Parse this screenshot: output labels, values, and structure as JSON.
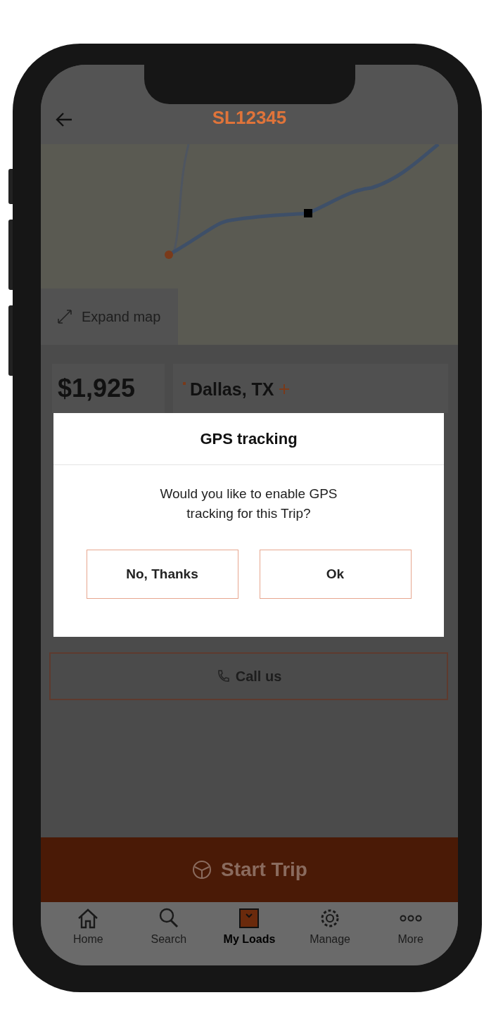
{
  "header": {
    "title": "SL12345"
  },
  "map": {
    "expand_label": "Expand map"
  },
  "summary": {
    "price": "$1,925",
    "origin": "Dallas, TX"
  },
  "call_button": {
    "label": "Call us"
  },
  "start_button": {
    "label": "Start Trip"
  },
  "nav": [
    {
      "label": "Home",
      "selected": false
    },
    {
      "label": "Search",
      "selected": false
    },
    {
      "label": "My Loads",
      "selected": true
    },
    {
      "label": "Manage",
      "selected": false
    },
    {
      "label": "More",
      "selected": false
    }
  ],
  "dialog": {
    "title": "GPS tracking",
    "message": "Would you like to enable GPS tracking for this Trip?",
    "buttons": [
      "No, Thanks",
      "Ok"
    ]
  }
}
